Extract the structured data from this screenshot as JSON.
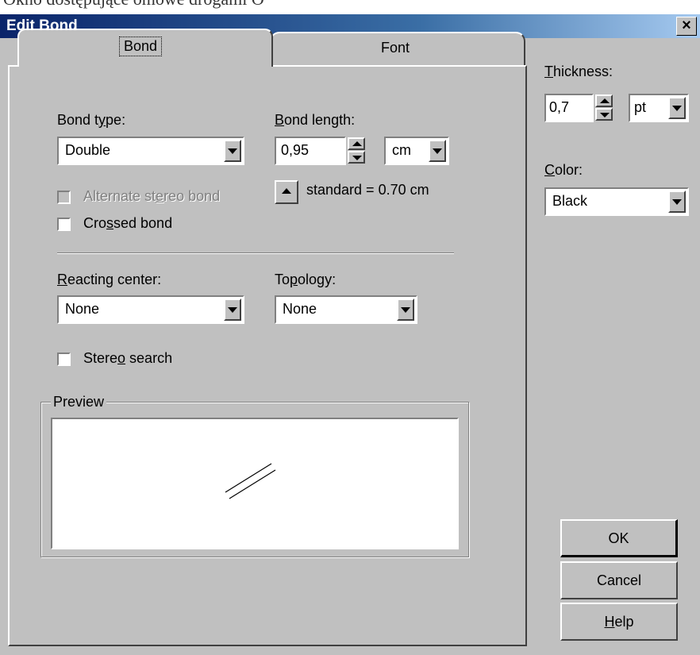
{
  "top_strip_text": "Okno dostępujące omowe drogami O",
  "window": {
    "title": "Edit Bond",
    "close_symbol": "×"
  },
  "tabs": [
    {
      "label": "Bond",
      "active": true
    },
    {
      "label": "Font",
      "active": false
    }
  ],
  "bond_type": {
    "label_pre": "Bond t",
    "label_u": "y",
    "label_post": "pe:",
    "value": "Double"
  },
  "bond_length": {
    "label_u": "B",
    "label_post": "ond length:",
    "value": "0,95",
    "unit": "cm",
    "standard_text": "standard = 0.70 cm"
  },
  "alternate_stereo": {
    "label_pre": "Alternate st",
    "label_u": "e",
    "label_post": "reo bond",
    "checked": false,
    "enabled": false
  },
  "crossed_bond": {
    "label_pre": "Cro",
    "label_u": "s",
    "label_post": "sed bond",
    "checked": false
  },
  "reacting_center": {
    "label_u": "R",
    "label_post": "eacting center:",
    "value": "None"
  },
  "topology": {
    "label_pre": "To",
    "label_u": "p",
    "label_post": "ology:",
    "value": "None"
  },
  "stereo_search": {
    "label_pre": "Stere",
    "label_u": "o",
    "label_post": " search",
    "checked": false
  },
  "preview": {
    "label": "Preview"
  },
  "thickness": {
    "label_u": "T",
    "label_post": "hickness:",
    "value": "0,7",
    "unit": "pt"
  },
  "color": {
    "label_u": "C",
    "label_post": "olor:",
    "value": "Black"
  },
  "buttons": {
    "ok": "OK",
    "cancel": "Cancel",
    "help_u": "H",
    "help_post": "elp"
  }
}
